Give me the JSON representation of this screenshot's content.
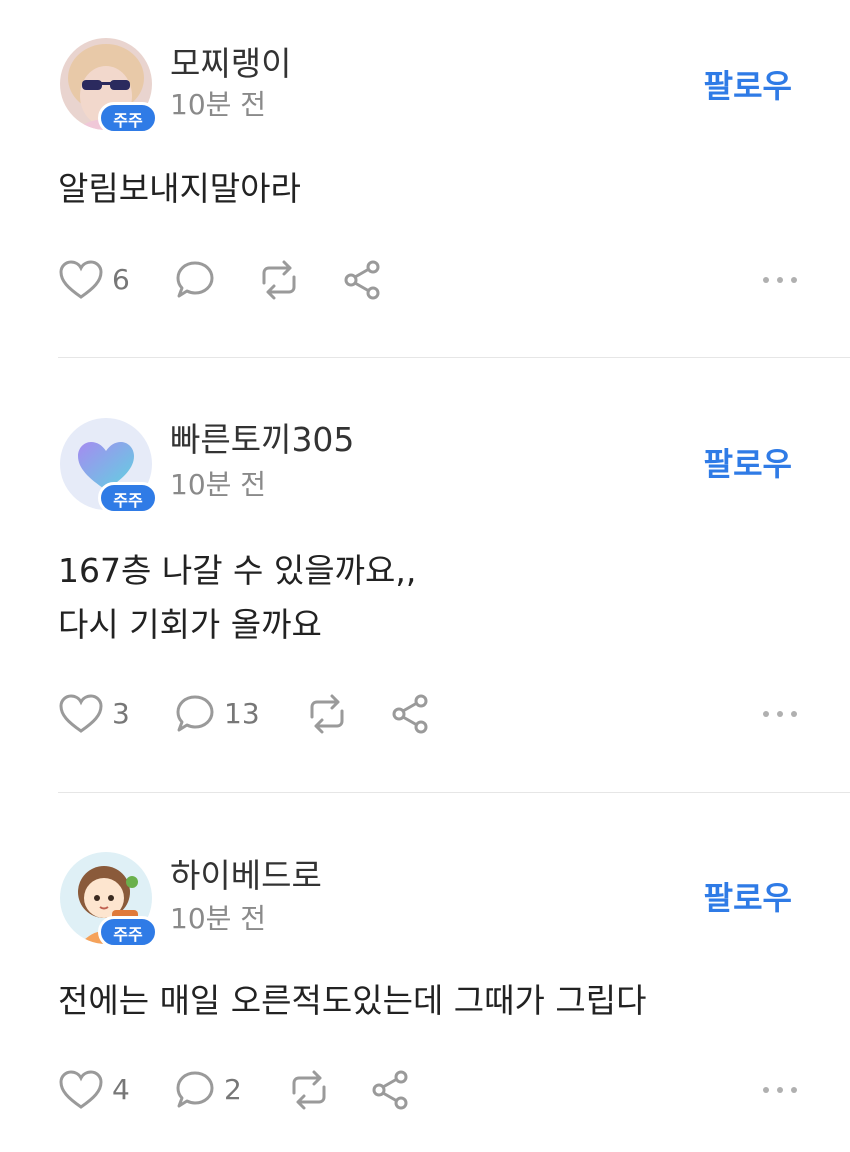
{
  "posts": [
    {
      "username": "모찌랭이",
      "time": "10분 전",
      "badge": "주주",
      "follow_label": "팔로우",
      "content_lines": [
        "알림보내지말아라"
      ],
      "likes": "6",
      "comments": "",
      "avatar": "girl-sunglasses-photo"
    },
    {
      "username": "빠른토끼305",
      "time": "10분 전",
      "badge": "주주",
      "follow_label": "팔로우",
      "content_lines": [
        "167층 나갈 수 있을까요,,",
        "다시 기회가 올까요"
      ],
      "likes": "3",
      "comments": "13",
      "avatar": "gradient-heart"
    },
    {
      "username": "하이베드로",
      "time": "10분 전",
      "badge": "주주",
      "follow_label": "팔로우",
      "content_lines": [
        "전에는 매일 오른적도있는데 그때가 그립다"
      ],
      "likes": "4",
      "comments": "2",
      "avatar": "cartoon-girl"
    }
  ],
  "colors": {
    "accent": "#2f7be6",
    "icon": "#9a9a9a",
    "text": "#222222",
    "muted": "#8a8a8a"
  }
}
